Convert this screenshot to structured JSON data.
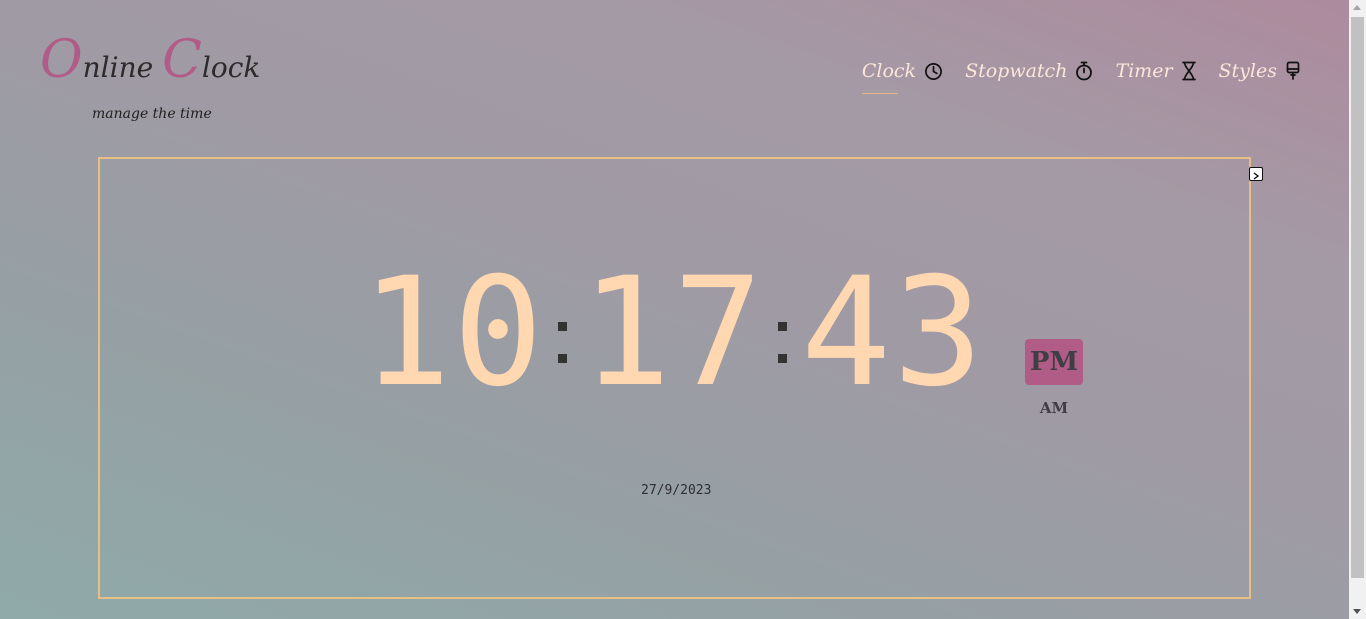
{
  "logo": {
    "first_cap": "O",
    "first_rest": "nline ",
    "second_cap": "C",
    "second_rest": "lock",
    "tagline": "manage the time"
  },
  "nav": {
    "items": [
      {
        "label": "Clock",
        "icon": "clock-icon",
        "active": true
      },
      {
        "label": "Stopwatch",
        "icon": "stopwatch-icon",
        "active": false
      },
      {
        "label": "Timer",
        "icon": "hourglass-icon",
        "active": false
      },
      {
        "label": "Styles",
        "icon": "brush-icon",
        "active": false
      }
    ]
  },
  "clock": {
    "hour_tens": "1",
    "hour_ones": "0",
    "minute_tens": "1",
    "minute_ones": "7",
    "second_tens": "4",
    "second_ones": "3",
    "period_active": "PM",
    "period_inactive": "AM",
    "date": "27/9/2023"
  },
  "controls": {
    "expand_icon": "expand-icon"
  },
  "colors": {
    "accent": "#b15c86",
    "digit": "#ffd8b2",
    "frame_border": "#e6be86",
    "nav_text": "#fbe6da"
  }
}
